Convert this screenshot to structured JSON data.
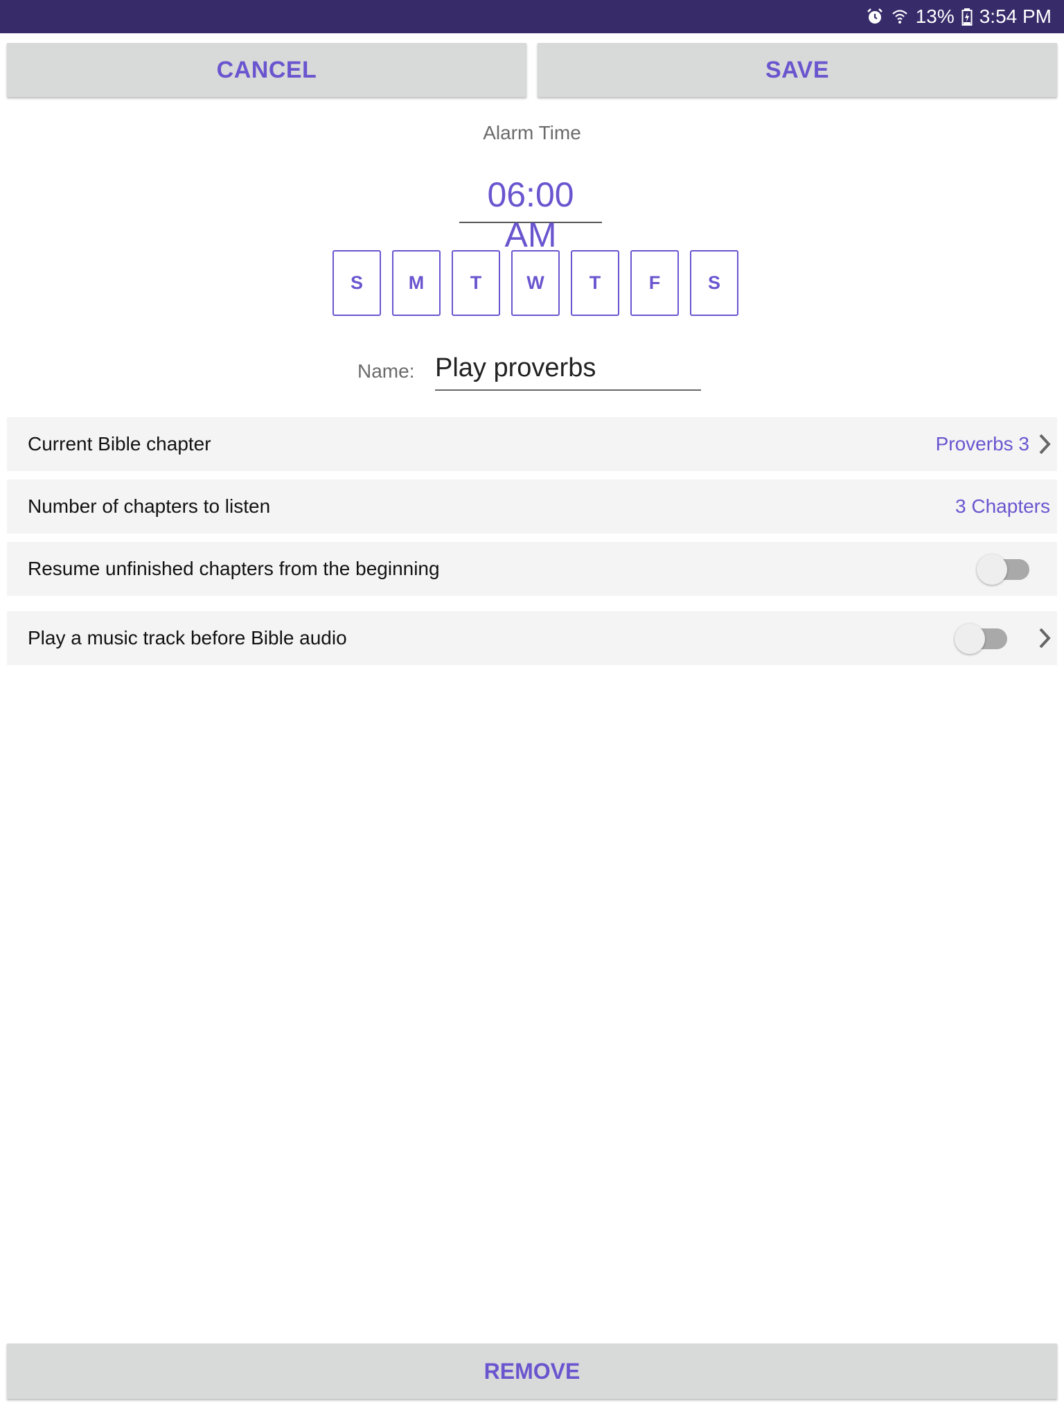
{
  "status_bar": {
    "battery_percent": "13%",
    "time": "3:54 PM",
    "icons": [
      "alarm-icon",
      "wifi-icon",
      "battery-charging-icon"
    ]
  },
  "actions": {
    "cancel_label": "CANCEL",
    "save_label": "SAVE",
    "remove_label": "REMOVE"
  },
  "alarm": {
    "label": "Alarm Time",
    "time": "06:00 AM"
  },
  "days": [
    "S",
    "M",
    "T",
    "W",
    "T",
    "F",
    "S"
  ],
  "name": {
    "label": "Name:",
    "value": "Play proverbs"
  },
  "settings": {
    "bible_chapter": {
      "label": "Current Bible chapter",
      "value": "Proverbs 3"
    },
    "chapters_count": {
      "label": "Number of chapters to listen",
      "value": "3 Chapters"
    },
    "resume": {
      "label": "Resume unfinished chapters from the beginning",
      "enabled": false
    },
    "music": {
      "label": "Play a music track before Bible audio",
      "enabled": false
    }
  },
  "colors": {
    "accent": "#6a55cf",
    "status_bar": "#372b6a",
    "button_bg": "#d8d9d9",
    "row_bg": "#f4f4f4"
  }
}
